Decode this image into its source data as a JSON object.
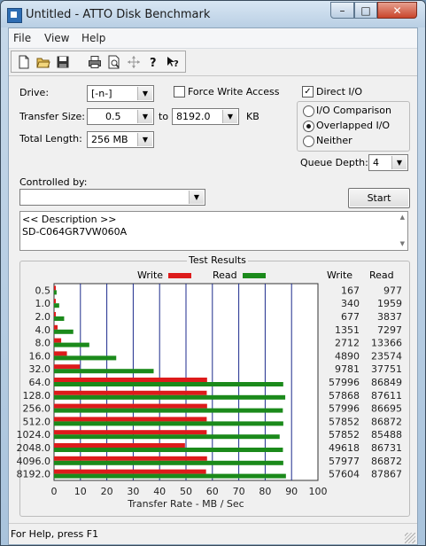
{
  "window": {
    "title": "Untitled - ATTO Disk Benchmark",
    "min_label": "–",
    "max_label": "□",
    "close_label": "✕"
  },
  "menu": [
    "File",
    "View",
    "Help"
  ],
  "toolbar": {
    "icons": [
      "new-document-icon",
      "open-folder-icon",
      "save-icon",
      "print-icon",
      "print-preview-icon",
      "move-icon",
      "help-icon",
      "context-help-icon"
    ]
  },
  "form": {
    "drive_label": "Drive:",
    "drive_value": "[-n-]",
    "force_write_label": "Force Write Access",
    "force_write_checked": false,
    "direct_io_label": "Direct I/O",
    "direct_io_checked": true,
    "transfer_size_label": "Transfer Size:",
    "transfer_from": "0.5",
    "to_label": "to",
    "transfer_to": "8192.0",
    "kb_label": "KB",
    "total_length_label": "Total Length:",
    "total_length_value": "256 MB",
    "io_options": [
      "I/O Comparison",
      "Overlapped I/O",
      "Neither"
    ],
    "io_selected": 1,
    "queue_depth_label": "Queue Depth:",
    "queue_depth_value": "4",
    "controlled_by_label": "Controlled by:",
    "controlled_by_value": "",
    "start_label": "Start",
    "description_line1": "<< Description >>",
    "description_line2": "SD-C064GR7VW060A"
  },
  "colors": {
    "write": "#dd1b1b",
    "read": "#1b8a1b",
    "grid": "#1c2a8c"
  },
  "results": {
    "group_label": "Test Results",
    "legend_write": "Write",
    "legend_read": "Read",
    "col_write": "Write",
    "col_read": "Read"
  },
  "chart_data": {
    "type": "bar",
    "orientation": "horizontal",
    "categories": [
      "0.5",
      "1.0",
      "2.0",
      "4.0",
      "8.0",
      "16.0",
      "32.0",
      "64.0",
      "128.0",
      "256.0",
      "512.0",
      "1024.0",
      "2048.0",
      "4096.0",
      "8192.0"
    ],
    "series": [
      {
        "name": "Write",
        "values": [
          167,
          340,
          677,
          1351,
          2712,
          4890,
          9781,
          57996,
          57868,
          57996,
          57852,
          57852,
          49618,
          57977,
          57604
        ]
      },
      {
        "name": "Read",
        "values": [
          977,
          1959,
          3837,
          7297,
          13366,
          23574,
          37751,
          86849,
          87611,
          86695,
          86872,
          85488,
          86731,
          86872,
          87867
        ]
      }
    ],
    "xlabel": "Transfer Rate - MB / Sec",
    "xticks": [
      0,
      10,
      20,
      30,
      40,
      50,
      60,
      70,
      80,
      90,
      100
    ],
    "xlim": [
      0,
      100
    ],
    "value_units": "KB/s",
    "grid": true,
    "legend": "top"
  },
  "status": {
    "text": "For Help, press F1"
  }
}
